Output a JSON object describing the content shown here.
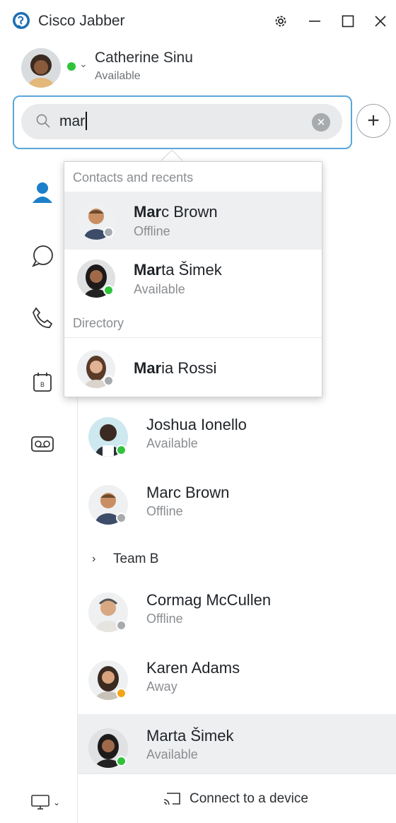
{
  "colors": {
    "accent": "#5aa6db",
    "available": "#30c33a",
    "offline": "#a8abae",
    "away": "#f2a51a",
    "brand": "#1b6fb5"
  },
  "window": {
    "title": "Cisco Jabber",
    "icons": [
      "settings-gear-icon",
      "minimize-icon",
      "maximize-icon",
      "close-icon"
    ]
  },
  "profile": {
    "name": "Catherine Sinu",
    "status": "Available",
    "presence": "available"
  },
  "search": {
    "query": "mar",
    "add_label": "+"
  },
  "sidebar": {
    "items": [
      "contacts-icon",
      "chat-icon",
      "phone-icon",
      "calendar-icon",
      "voicemail-icon"
    ],
    "calendar_glyph": "B",
    "device_icon": "monitor-icon"
  },
  "dropdown": {
    "contacts_header": "Contacts and recents",
    "directory_header": "Directory",
    "contacts": [
      {
        "match": "Mar",
        "rest": "c Brown",
        "status": "Offline",
        "presence": "offline"
      },
      {
        "match": "Mar",
        "rest": "ta Šimek",
        "status": "Available",
        "presence": "available"
      }
    ],
    "directory": [
      {
        "match": "Mar",
        "rest": "ia Rossi",
        "presence": "offline"
      }
    ]
  },
  "contacts": [
    {
      "name": "Joshua Ionello",
      "status": "Available",
      "presence": "available"
    },
    {
      "name": "Marc Brown",
      "status": "Offline",
      "presence": "offline"
    }
  ],
  "group": {
    "label": "Team B",
    "chevron": "›"
  },
  "group_contacts": [
    {
      "name": "Cormag McCullen",
      "status": "Offline",
      "presence": "offline"
    },
    {
      "name": "Karen Adams",
      "status": "Away",
      "presence": "away"
    },
    {
      "name": "Marta Šimek",
      "status": "Available",
      "presence": "available"
    }
  ],
  "bottom": {
    "connect_label": "Connect to a device"
  }
}
